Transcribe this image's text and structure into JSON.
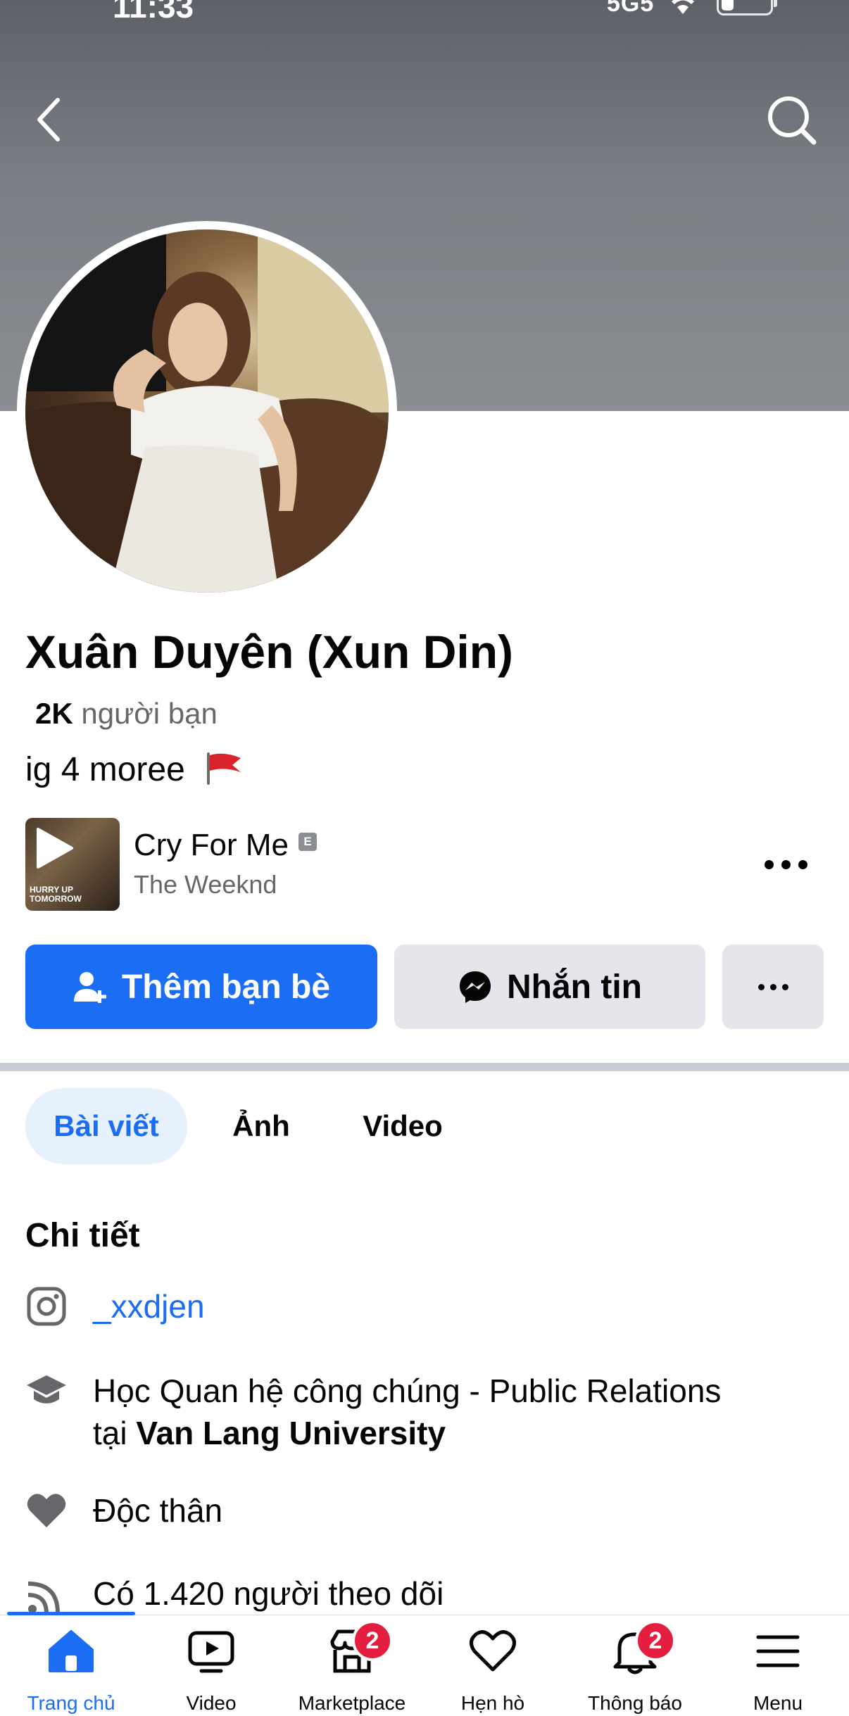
{
  "status_bar": {
    "time": "11:33",
    "network": "5G5",
    "battery_level": 0.25
  },
  "header": {
    "back_icon": "chevron-left-icon",
    "search_icon": "search-icon"
  },
  "profile": {
    "name": "Xuân Duyên (Xun Din)",
    "friends_count": "2K",
    "friends_label": "người bạn",
    "bio": "ig 4 moree"
  },
  "music": {
    "title": "Cry For Me",
    "explicit_label": "E",
    "artist": "The Weeknd",
    "album_text": "HURRY UP TOMORROW"
  },
  "actions": {
    "add_friend": "Thêm bạn bè",
    "message": "Nhắn tin"
  },
  "tabs": [
    {
      "label": "Bài viết",
      "active": true
    },
    {
      "label": "Ảnh",
      "active": false
    },
    {
      "label": "Video",
      "active": false
    }
  ],
  "details": {
    "title": "Chi tiết",
    "instagram": "_xxdjen",
    "education_prefix": "Học Quan hệ công chúng - Public Relations",
    "education_at": "tại",
    "education_school": "Van Lang University",
    "relationship": "Độc thân",
    "followers": "Có 1.420 người theo dõi"
  },
  "bottom_nav": [
    {
      "label": "Trang chủ",
      "icon": "home-icon",
      "active": true
    },
    {
      "label": "Video",
      "icon": "video-icon",
      "active": false
    },
    {
      "label": "Marketplace",
      "icon": "marketplace-icon",
      "badge": "2",
      "active": false
    },
    {
      "label": "Hẹn hò",
      "icon": "dating-heart-icon",
      "active": false
    },
    {
      "label": "Thông báo",
      "icon": "bell-icon",
      "badge": "2",
      "active": false
    },
    {
      "label": "Menu",
      "icon": "menu-icon",
      "active": false
    }
  ],
  "colors": {
    "accent": "#1b6ef3",
    "badge": "#e41e3f",
    "secondary_text": "#65676b"
  }
}
